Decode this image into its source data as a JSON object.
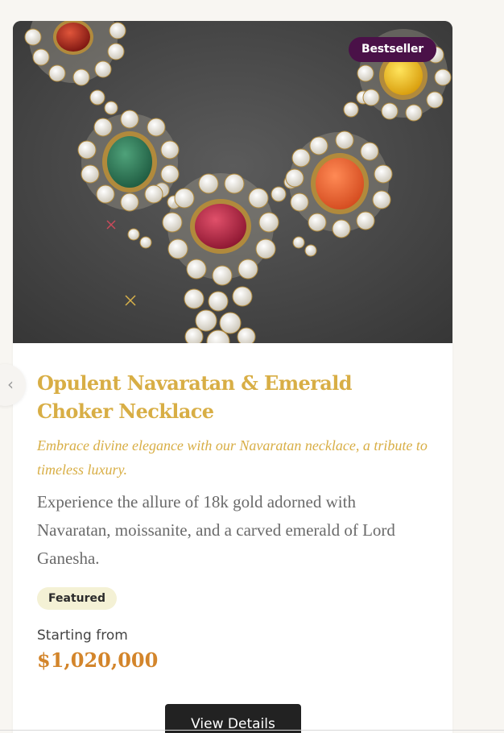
{
  "product": {
    "badge": "Bestseller",
    "image_alt": "Navaratan and emerald choker necklace on grey display",
    "title": "Opulent Navaratan & Emerald Choker Necklace",
    "tagline": "Embrace divine elegance with our Navaratan necklace, a tribute to timeless luxury.",
    "description": "Experience the allure of 18k gold adorned with Navaratan, moissanite, and a carved emerald of Lord Ganesha.",
    "tag": "Featured",
    "price_label": "Starting from",
    "price": "$1,020,000",
    "cta": "View Details"
  },
  "nav": {
    "prev_icon": "chevron-left-icon",
    "prev_glyph": "‹"
  },
  "colors": {
    "gold_text": "#d8ae45",
    "price": "#d3852b",
    "badge_bg": "#4a1148",
    "tag_bg": "#f4f1d5",
    "button_bg": "#222222"
  }
}
